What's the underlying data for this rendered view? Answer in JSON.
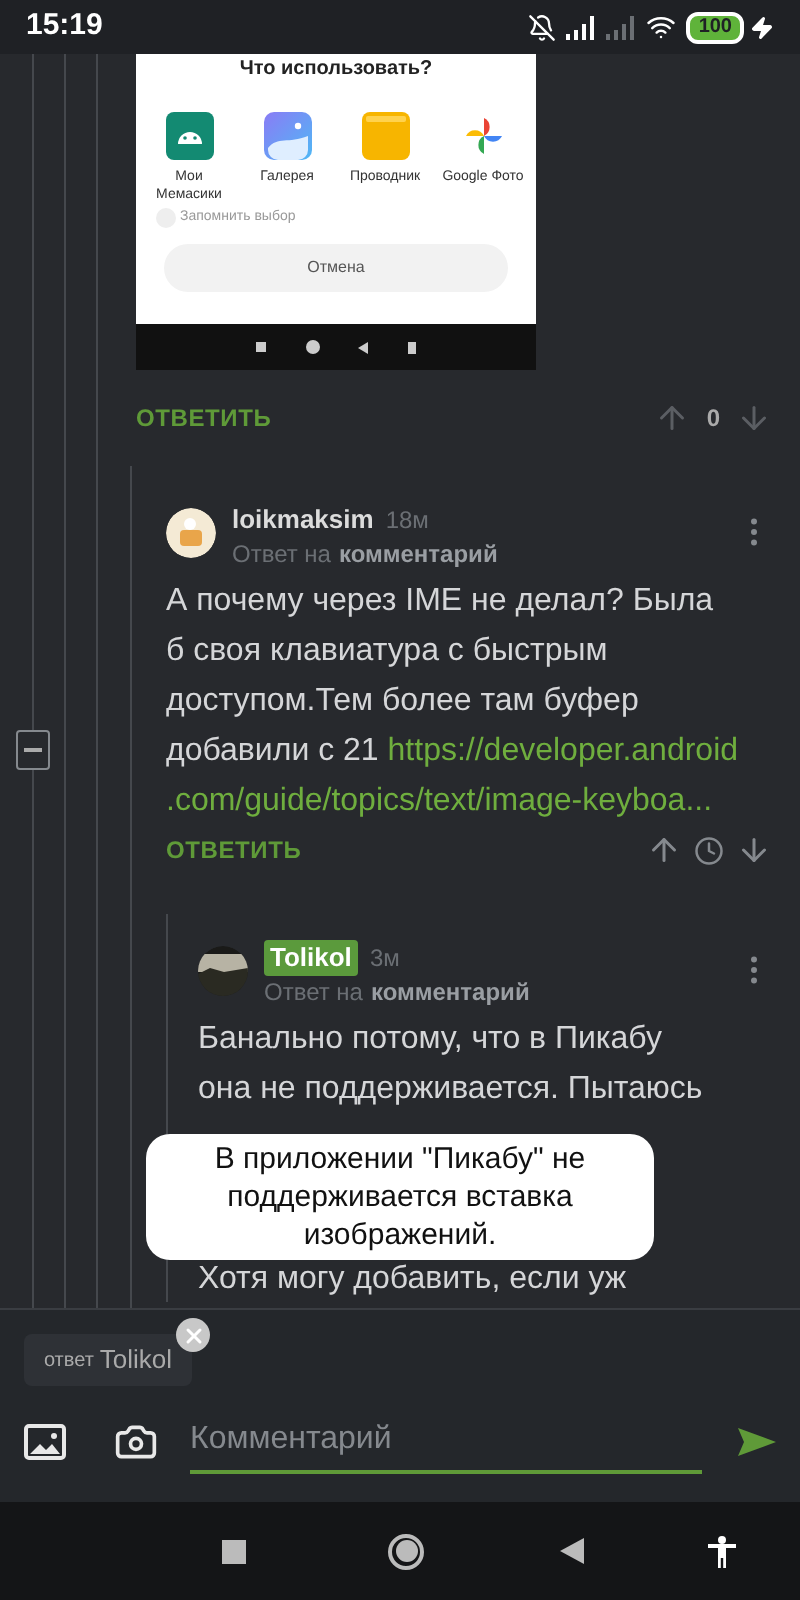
{
  "status_bar": {
    "time": "15:19",
    "battery": "100"
  },
  "attachment": {
    "dialog_title": "Что использовать?",
    "apps": [
      {
        "kind": "android",
        "label": "Мои Мемасики"
      },
      {
        "kind": "gallery",
        "label": "Галерея"
      },
      {
        "kind": "folder",
        "label": "Проводник"
      },
      {
        "kind": "pinwheel",
        "label": "Google Фото"
      }
    ],
    "remember": {
      "label": "Запомнить выбор",
      "checked": false
    },
    "cancel": "Отмена"
  },
  "first_footer": {
    "reply": "ОТВЕТИТЬ",
    "rating": "0"
  },
  "comments": [
    {
      "author": "loikmaksim",
      "highlighted": false,
      "time": "18м",
      "reply_prefix": "Ответ на",
      "reply_target": "комментарий",
      "body_lines": [
        "А почему через IME не делал? Была",
        "б своя клавиатура с быстрым",
        "доступом.Тем более там буфер",
        "добавили с 21"
      ],
      "link_lines": [
        "https://developer.android",
        ".com/guide/topics/text/image-keyboa..."
      ],
      "footer_reply": "ОТВЕТИТЬ"
    },
    {
      "author": "Tolikol",
      "highlighted": true,
      "time": "3м",
      "reply_prefix": "Ответ на",
      "reply_target": "комментарий",
      "body_lines": [
        "Банально потому, что в Пикабу",
        "она не поддерживается. Пытаюсь"
      ],
      "body_after_toast": "Хотя могу добавить, если уж"
    }
  ],
  "toast": "В приложении \"Пикабу\" не поддерживается вставка изображений.",
  "composer": {
    "reply_prefix": "ответ",
    "reply_name": "Tolikol",
    "placeholder": "Комментарий"
  }
}
